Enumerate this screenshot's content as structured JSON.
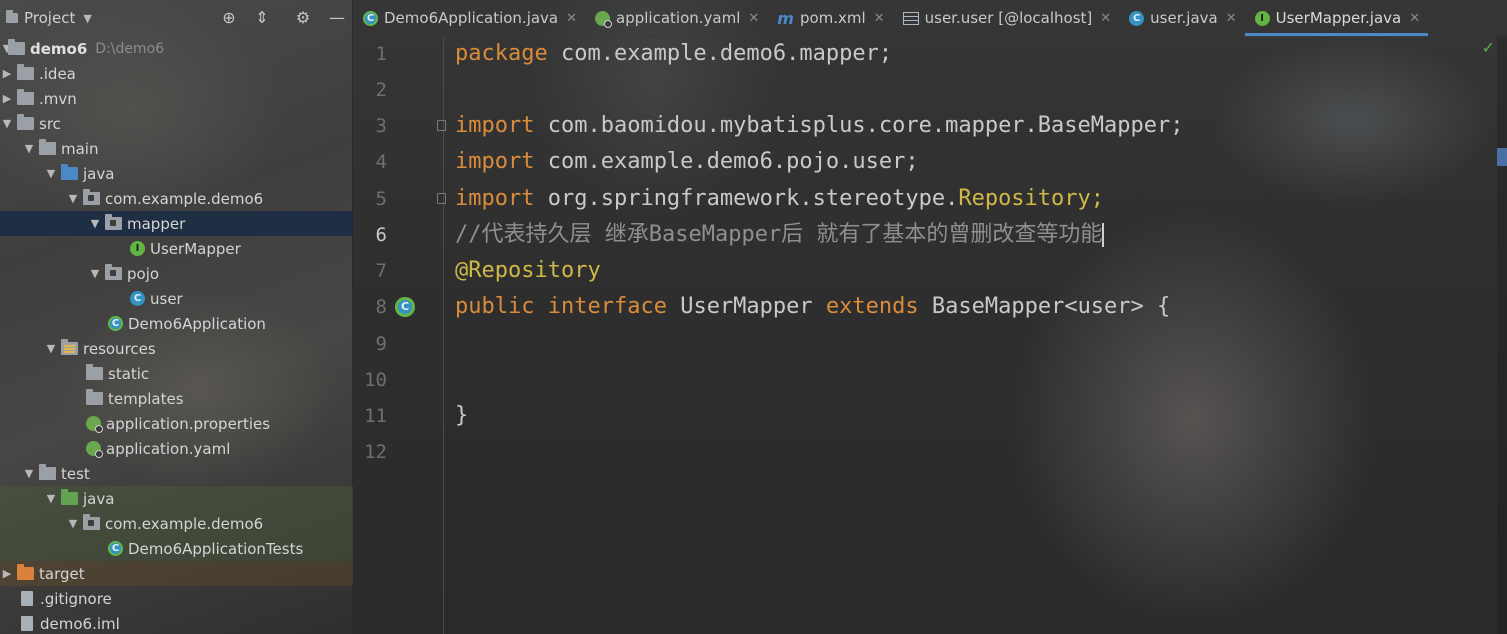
{
  "project_panel": {
    "title": "Project",
    "tree": [
      {
        "label": "demo6",
        "secondary": "D:\\demo6"
      },
      {
        "label": ".idea"
      },
      {
        "label": ".mvn"
      },
      {
        "label": "src"
      },
      {
        "label": "main"
      },
      {
        "label": "java"
      },
      {
        "label": "com.example.demo6"
      },
      {
        "label": "mapper"
      },
      {
        "label": "UserMapper"
      },
      {
        "label": "pojo"
      },
      {
        "label": "user"
      },
      {
        "label": "Demo6Application"
      },
      {
        "label": "resources"
      },
      {
        "label": "static"
      },
      {
        "label": "templates"
      },
      {
        "label": "application.properties"
      },
      {
        "label": "application.yaml"
      },
      {
        "label": "test"
      },
      {
        "label": "java"
      },
      {
        "label": "com.example.demo6"
      },
      {
        "label": "Demo6ApplicationTests"
      },
      {
        "label": "target"
      },
      {
        "label": ".gitignore"
      },
      {
        "label": "demo6.iml"
      }
    ]
  },
  "tabs": [
    {
      "label": "Demo6Application.java",
      "icon": "spring-run-class-icon"
    },
    {
      "label": "application.yaml",
      "icon": "yaml-config-icon"
    },
    {
      "label": "pom.xml",
      "icon": "maven-icon"
    },
    {
      "label": "user.user [@localhost]",
      "icon": "table-icon"
    },
    {
      "label": "user.java",
      "icon": "class-icon"
    },
    {
      "label": "UserMapper.java",
      "icon": "interface-icon",
      "active": true
    }
  ],
  "editor": {
    "line_numbers": [
      "1",
      "2",
      "3",
      "4",
      "5",
      "6",
      "7",
      "8",
      "9",
      "10",
      "11",
      "12"
    ],
    "current_line": 6,
    "lines": [
      {
        "kw": "package",
        "rest": " com.example.demo6.mapper;"
      },
      {},
      {
        "kw": "import",
        "rest": " com.baomidou.mybatisplus.core.mapper.BaseMapper;"
      },
      {
        "kw": "import",
        "rest": " com.example.demo6.pojo.user;"
      },
      {
        "kw": "import",
        "rest": " org.springframework.stereotype.",
        "ann": "Repository;"
      },
      {
        "comment": "//代表持久层 继承BaseMapper后 就有了基本的曾删改查等功能"
      },
      {
        "ann": "@Repository"
      },
      {
        "kw": "public",
        "kw2": "interface",
        "rest": " UserMapper ",
        "kw3": "extends",
        "rest2": " BaseMapper<user> {"
      },
      {},
      {},
      {
        "rest": "}"
      },
      {}
    ]
  },
  "colors": {
    "keyword": "#d98c3a",
    "annotation": "#d0b847",
    "comment": "#8f8f8f",
    "accent": "#4a88c7"
  }
}
